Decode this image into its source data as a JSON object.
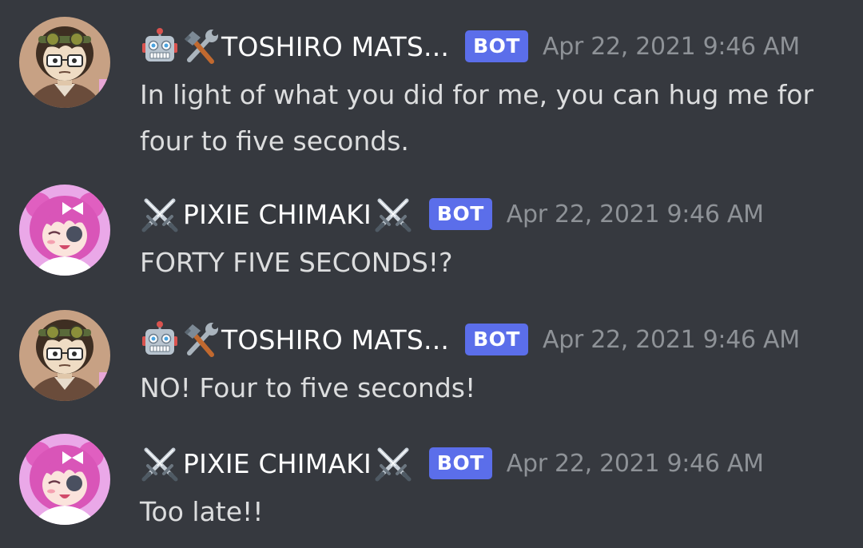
{
  "messages": [
    {
      "author": "TOSHIRO MATS...",
      "bot_tag": "BOT",
      "timestamp": "Apr 22, 2021 9:46 AM",
      "text": "In light of what you did for me, you can hug me for four to five seconds.",
      "prefix_icons": [
        "robot-icon",
        "hammer-and-wrench-icon"
      ],
      "avatar": "toshiro-avatar"
    },
    {
      "author": "PIXIE CHIMAKI",
      "bot_tag": "BOT",
      "timestamp": "Apr 22, 2021 9:46 AM",
      "text": "FORTY FIVE SECONDS!?",
      "prefix_icons": [
        "crossed-swords-icon"
      ],
      "suffix_icons": [
        "crossed-swords-icon"
      ],
      "avatar": "pixie-avatar"
    },
    {
      "author": "TOSHIRO MATS...",
      "bot_tag": "BOT",
      "timestamp": "Apr 22, 2021 9:46 AM",
      "text": "NO! Four to five seconds!",
      "prefix_icons": [
        "robot-icon",
        "hammer-and-wrench-icon"
      ],
      "avatar": "toshiro-avatar"
    },
    {
      "author": "PIXIE CHIMAKI",
      "bot_tag": "BOT",
      "timestamp": "Apr 22, 2021 9:46 AM",
      "text": "Too late!!",
      "prefix_icons": [
        "crossed-swords-icon"
      ],
      "suffix_icons": [
        "crossed-swords-icon"
      ],
      "avatar": "pixie-avatar"
    }
  ],
  "colors": {
    "background": "#36393f",
    "username": "#ffffff",
    "bot_tag": "#5b6eea",
    "timestamp": "#8e9297",
    "message_text": "#dcddde"
  }
}
